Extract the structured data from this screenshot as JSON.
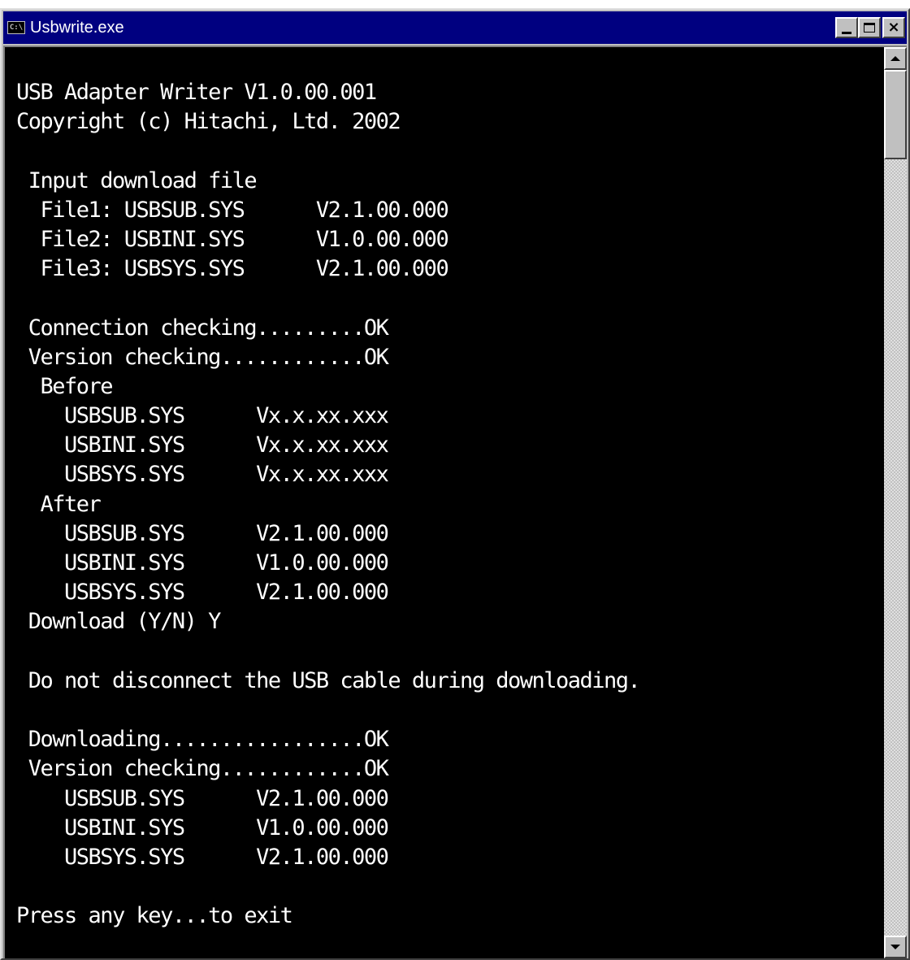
{
  "window": {
    "title": "Usbwrite.exe",
    "icon_label": "C:\\",
    "buttons": {
      "minimize": "minimize-icon",
      "maximize": "maximize-icon",
      "close": "×"
    }
  },
  "console": {
    "lines": [
      "USB Adapter Writer V1.0.00.001",
      "Copyright (c) Hitachi, Ltd. 2002",
      "",
      " Input download file",
      "  File1: USBSUB.SYS      V2.1.00.000",
      "  File2: USBINI.SYS      V1.0.00.000",
      "  File3: USBSYS.SYS      V2.1.00.000",
      "",
      " Connection checking.........OK",
      " Version checking............OK",
      "  Before",
      "    USBSUB.SYS      Vx.x.xx.xxx",
      "    USBINI.SYS      Vx.x.xx.xxx",
      "    USBSYS.SYS      Vx.x.xx.xxx",
      "  After",
      "    USBSUB.SYS      V2.1.00.000",
      "    USBINI.SYS      V1.0.00.000",
      "    USBSYS.SYS      V2.1.00.000",
      " Download (Y/N) Y",
      "",
      " Do not disconnect the USB cable during downloading.",
      "",
      " Downloading.................OK",
      " Version checking............OK",
      "    USBSUB.SYS      V2.1.00.000",
      "    USBINI.SYS      V1.0.00.000",
      "    USBSYS.SYS      V2.1.00.000",
      "",
      "Press any key...to exit"
    ]
  },
  "colors": {
    "titlebar": "#000080",
    "console_bg": "#000000",
    "console_fg": "#ffffff",
    "chrome": "#c0c0c0"
  }
}
